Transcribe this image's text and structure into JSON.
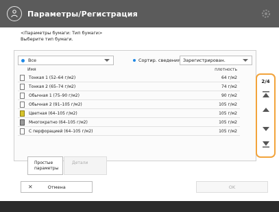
{
  "header": {
    "title": "Параметры/Регистрация"
  },
  "instructions": {
    "line1": "<Параметры бумаги: Тип бумаги>",
    "line2": "Выберите тип бумаги."
  },
  "filter": {
    "value": "Все"
  },
  "sort": {
    "label": "Сортир. сведения",
    "value": "Зарегистрирован."
  },
  "table": {
    "col_name": "Имя",
    "col_weight": "плотность",
    "rows": [
      {
        "name": "Тонкая 1 (52–64 г/м2)",
        "weight": "64 г/м2",
        "icon": "paper-plain"
      },
      {
        "name": "Тонкая 2 (65–74 г/м2)",
        "weight": "74 г/м2",
        "icon": "paper-plain"
      },
      {
        "name": "Обычная 1 (75–90 г/м2)",
        "weight": "90 г/м2",
        "icon": "paper-plain"
      },
      {
        "name": "Обычная 2 (91–105 г/м2)",
        "weight": "105 г/м2",
        "icon": "paper-plain"
      },
      {
        "name": "Цветная (64–105 г/м2)",
        "weight": "105 г/м2",
        "icon": "paper-color"
      },
      {
        "name": "Многократно (64–105 г/м2)",
        "weight": "105 г/м2",
        "icon": "paper-recycled"
      },
      {
        "name": "С перфорацией (64–105 г/м2)",
        "weight": "105 г/м2",
        "icon": "paper-punched"
      }
    ]
  },
  "scroll": {
    "page": "2/4"
  },
  "buttons": {
    "simple": "Простые параметры",
    "detail": "Детали",
    "cancel": "Отмена",
    "ok": "OK"
  },
  "icons": {
    "header": "settings-registration-icon",
    "gear": "gear-icon"
  },
  "colors": {
    "header_bg": "#5b5b5b",
    "accent": "#f2a33a",
    "dot": "#1e88e5"
  }
}
